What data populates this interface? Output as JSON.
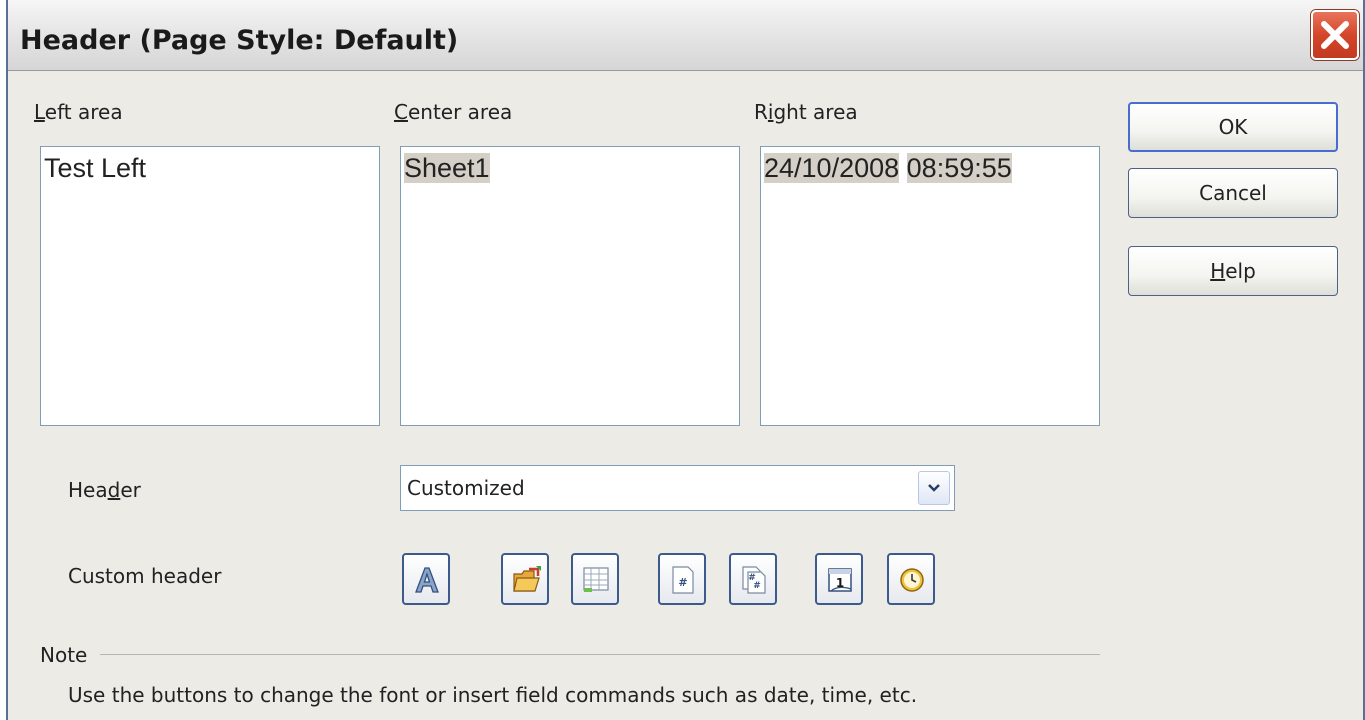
{
  "window": {
    "title": "Header (Page Style: Default)"
  },
  "areas": {
    "left": {
      "label": "Left area",
      "accel": "L",
      "rest": "eft area",
      "content": "Test Left"
    },
    "center": {
      "label": "Center area",
      "accel": "C",
      "rest": "enter area",
      "content": "Sheet1"
    },
    "right": {
      "label": "Right area",
      "pre": "R",
      "accel": "i",
      "rest": "ght area",
      "date": "24/10/2008",
      "time": "08:59:55"
    }
  },
  "buttons": {
    "ok": "OK",
    "cancel": "Cancel",
    "help": {
      "label": "Help",
      "accel": "H",
      "rest": "elp"
    }
  },
  "header_row": {
    "label": "Header",
    "pre": "Hea",
    "accel": "d",
    "rest": "er",
    "value": "Customized"
  },
  "custom_header": {
    "label": "Custom header",
    "tools": [
      {
        "icon": "text-attributes-icon"
      },
      {
        "icon": "file-name-icon"
      },
      {
        "icon": "sheet-name-icon"
      },
      {
        "icon": "page-icon"
      },
      {
        "icon": "pages-icon"
      },
      {
        "icon": "date-icon"
      },
      {
        "icon": "time-icon"
      }
    ]
  },
  "note": {
    "label": "Note",
    "text": "Use the buttons to change the font or insert field commands such as date, time, etc."
  }
}
